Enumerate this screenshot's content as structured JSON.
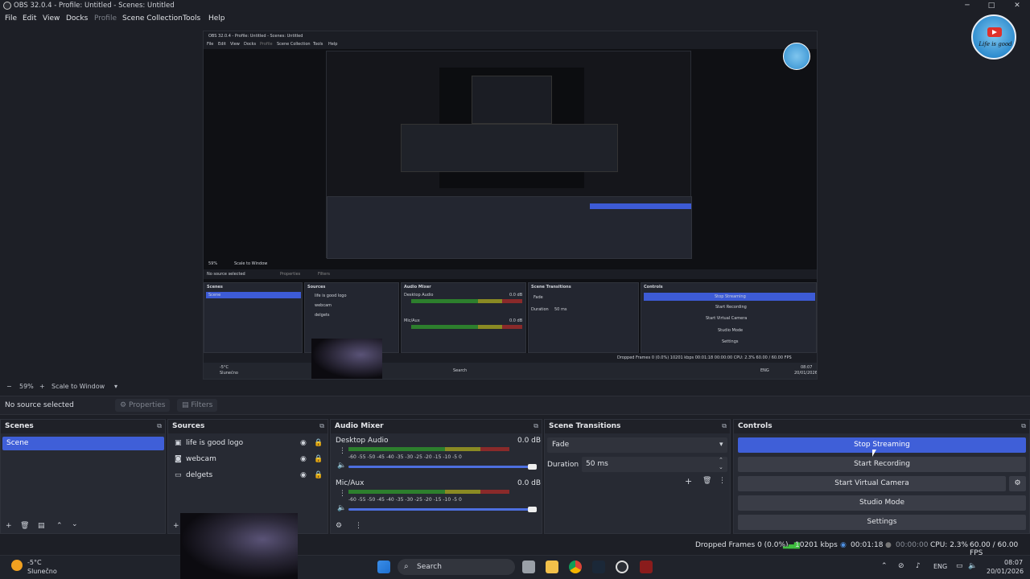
{
  "window": {
    "title": "OBS 32.0.4 - Profile: Untitled - Scenes: Untitled",
    "minimize": "─",
    "maximize": "□",
    "close": "✕"
  },
  "menu": [
    "File",
    "Edit",
    "View",
    "Docks",
    "Profile",
    "Scene Collection",
    "Tools",
    "Help"
  ],
  "logo": {
    "text": "Life is good"
  },
  "preview_nested": {
    "title": "OBS 32.0.4 - Profile: Untitled - Scenes: Untitled",
    "menu": [
      "File",
      "Edit",
      "View",
      "Docks",
      "Profile",
      "Scene Collection",
      "Tools",
      "Help"
    ],
    "zoom": "59%",
    "scale": "Scale to Window",
    "no_source": "No source selected",
    "properties": "Properties",
    "filters": "Filters",
    "scenes_title": "Scenes",
    "scene": "Scene",
    "sources_title": "Sources",
    "sources": [
      "life is good logo",
      "webcam",
      "delgets"
    ],
    "mixer_title": "Audio Mixer",
    "desktop_audio": "Desktop Audio",
    "mic": "Mic/Aux",
    "db": "0.0 dB",
    "transitions_title": "Scene Transitions",
    "fade": "Fade",
    "duration": "Duration",
    "duration_value": "50 ms",
    "controls_title": "Controls",
    "controls": [
      "Stop Streaming",
      "Start Recording",
      "Start Virtual Camera",
      "Studio Mode",
      "Settings"
    ],
    "status": "Dropped Frames 0 (0.0%)   10201 kbps   00:01:18   00:00:00   CPU: 2.3%   60.00 / 60.00 FPS",
    "weather_temp": "-5°C",
    "weather_desc": "Slunečno",
    "search": "Search",
    "lang": "ENG",
    "time": "08:07",
    "date": "20/01/2026"
  },
  "zoom": {
    "minus": "−",
    "value": "59%",
    "plus": "+",
    "scale": "Scale to Window"
  },
  "source_toolbar": {
    "no_source": "No source selected",
    "properties": "Properties",
    "filters": "Filters"
  },
  "scenes": {
    "title": "Scenes",
    "items": [
      "Scene"
    ]
  },
  "sources": {
    "title": "Sources",
    "items": [
      {
        "name": "life is good logo",
        "icon": "image-icon"
      },
      {
        "name": "webcam",
        "icon": "camera-icon"
      },
      {
        "name": "delgets",
        "icon": "window-icon"
      }
    ]
  },
  "audio_mixer": {
    "title": "Audio Mixer",
    "channels": [
      {
        "name": "Desktop Audio",
        "db": "0.0 dB",
        "volume": 1.0
      },
      {
        "name": "Mic/Aux",
        "db": "0.0 dB",
        "volume": 1.0
      }
    ],
    "scale": [
      "-60",
      "-55",
      "-50",
      "-45",
      "-40",
      "-35",
      "-30",
      "-25",
      "-20",
      "-15",
      "-10",
      "-5",
      "0"
    ]
  },
  "scene_transitions": {
    "title": "Scene Transitions",
    "transition": "Fade",
    "duration_label": "Duration",
    "duration_value": "50 ms"
  },
  "controls": {
    "title": "Controls",
    "stop_streaming": "Stop Streaming",
    "start_recording": "Start Recording",
    "start_virtual_camera": "Start Virtual Camera",
    "studio_mode": "Studio Mode",
    "settings": "Settings"
  },
  "status": {
    "dropped_frames": "Dropped Frames 0 (0.0%)",
    "bitrate": "10201 kbps",
    "stream_time": "00:01:18",
    "record_time": "00:00:00",
    "cpu": "CPU: 2.3%",
    "fps": "60.00 / 60.00 FPS"
  },
  "taskbar": {
    "weather_temp": "-5°C",
    "weather_desc": "Slunečno",
    "search": "Search",
    "lang": "ENG",
    "time": "08:07",
    "date": "20/01/2026"
  },
  "colors": {
    "accent": "#3f5fd8",
    "bg": "#1d1f26",
    "dock": "#272a33"
  }
}
